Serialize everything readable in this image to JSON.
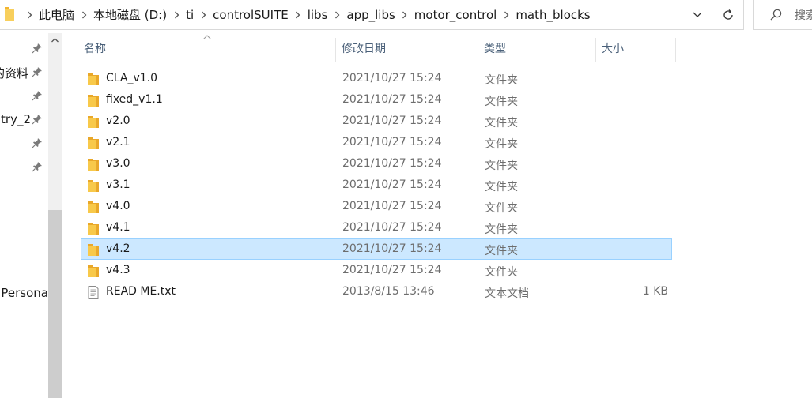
{
  "address_bar": {
    "breadcrumbs": [
      "此电脑",
      "本地磁盘 (D:)",
      "ti",
      "controlSUITE",
      "libs",
      "app_libs",
      "motor_control",
      "math_blocks"
    ]
  },
  "search": {
    "placeholder": "搜索"
  },
  "navigation": {
    "items": [
      {
        "label": "",
        "pinned": true
      },
      {
        "label": "的资料",
        "pinned": true
      },
      {
        "label": "",
        "pinned": true
      },
      {
        "label": "ntry_2",
        "pinned": true
      },
      {
        "label": "",
        "pinned": true
      },
      {
        "label": "",
        "pinned": true
      }
    ],
    "bottom_item": "Persona"
  },
  "columns": {
    "name": "名称",
    "date": "修改日期",
    "type": "类型",
    "size": "大小"
  },
  "files": [
    {
      "name": "CLA_v1.0",
      "date": "2021/10/27 15:24",
      "type": "文件夹",
      "size": "",
      "icon": "folder-icon"
    },
    {
      "name": "fixed_v1.1",
      "date": "2021/10/27 15:24",
      "type": "文件夹",
      "size": "",
      "icon": "folder-icon"
    },
    {
      "name": "v2.0",
      "date": "2021/10/27 15:24",
      "type": "文件夹",
      "size": "",
      "icon": "folder-icon"
    },
    {
      "name": "v2.1",
      "date": "2021/10/27 15:24",
      "type": "文件夹",
      "size": "",
      "icon": "folder-icon"
    },
    {
      "name": "v3.0",
      "date": "2021/10/27 15:24",
      "type": "文件夹",
      "size": "",
      "icon": "folder-icon"
    },
    {
      "name": "v3.1",
      "date": "2021/10/27 15:24",
      "type": "文件夹",
      "size": "",
      "icon": "folder-icon"
    },
    {
      "name": "v4.0",
      "date": "2021/10/27 15:24",
      "type": "文件夹",
      "size": "",
      "icon": "folder-icon"
    },
    {
      "name": "v4.1",
      "date": "2021/10/27 15:24",
      "type": "文件夹",
      "size": "",
      "icon": "folder-icon"
    },
    {
      "name": "v4.2",
      "date": "2021/10/27 15:24",
      "type": "文件夹",
      "size": "",
      "icon": "folder-icon",
      "selected": true
    },
    {
      "name": "v4.3",
      "date": "2021/10/27 15:24",
      "type": "文件夹",
      "size": "",
      "icon": "folder-icon"
    },
    {
      "name": "READ ME.txt",
      "date": "2013/8/15 13:46",
      "type": "文本文档",
      "size": "1 KB",
      "icon": "text-file-icon"
    }
  ],
  "colors": {
    "selection_bg": "#cce8ff",
    "selection_border": "#99d1ff",
    "folder_yellow": "#f8c94a",
    "header_text": "#4a6079"
  }
}
